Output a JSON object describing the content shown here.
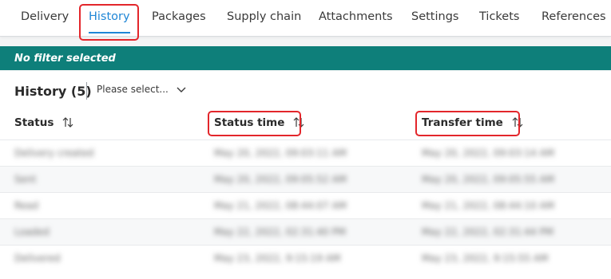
{
  "tabs": [
    {
      "label": "Delivery",
      "active": false
    },
    {
      "label": "History",
      "active": true
    },
    {
      "label": "Packages",
      "active": false
    },
    {
      "label": "Supply chain",
      "active": false
    },
    {
      "label": "Attachments",
      "active": false
    },
    {
      "label": "Settings",
      "active": false
    },
    {
      "label": "Tickets",
      "active": false
    },
    {
      "label": "References",
      "active": false
    }
  ],
  "filter": {
    "text": "No filter selected"
  },
  "history": {
    "title": "History (5)",
    "select_placeholder": "Please select...",
    "columns": {
      "status": "Status",
      "status_time": "Status time",
      "transfer_time": "Transfer time"
    },
    "rows": [
      {
        "status": "Delivery created",
        "status_time": "May 20, 2022, 09:03:11 AM",
        "transfer_time": "May 20, 2022, 09:03:14 AM"
      },
      {
        "status": "Sent",
        "status_time": "May 20, 2022, 09:05:52 AM",
        "transfer_time": "May 20, 2022, 09:05:55 AM"
      },
      {
        "status": "Read",
        "status_time": "May 21, 2022, 08:44:07 AM",
        "transfer_time": "May 21, 2022, 08:44:10 AM"
      },
      {
        "status": "Loaded",
        "status_time": "May 22, 2022, 02:31:40 PM",
        "transfer_time": "May 22, 2022, 02:31:44 PM"
      },
      {
        "status": "Delivered",
        "status_time": "May 23, 2022, 9:15:19 AM",
        "transfer_time": "May 23, 2022, 9:15:55 AM"
      }
    ]
  },
  "colors": {
    "accent": "#1f86d6",
    "filter_bar": "#0e7f7a",
    "highlight": "#e3262b"
  },
  "icons": {
    "sort": "sort-arrows-icon",
    "dropdown": "chevron-down-icon"
  }
}
